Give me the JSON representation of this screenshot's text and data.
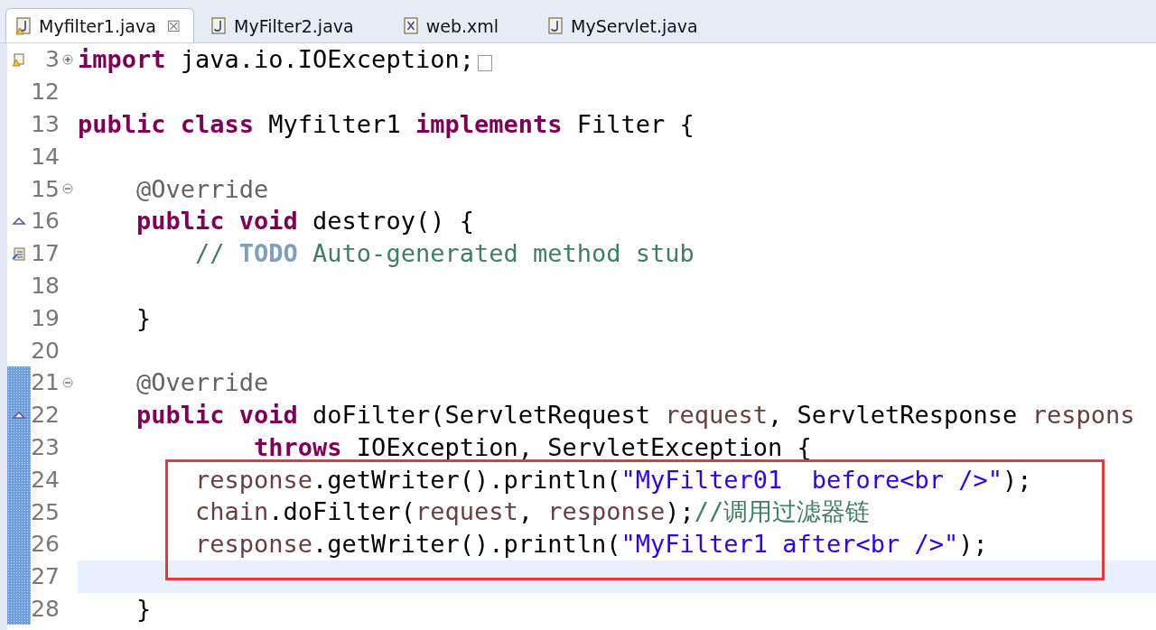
{
  "tabs": [
    {
      "label": "Myfilter1.java",
      "kind": "java",
      "selected": true,
      "warning": true,
      "close": "☒"
    },
    {
      "label": "MyFilter2.java",
      "kind": "java",
      "selected": false,
      "warning": false
    },
    {
      "label": "web.xml",
      "kind": "xml",
      "selected": false,
      "warning": false
    },
    {
      "label": "MyServlet.java",
      "kind": "java",
      "selected": false,
      "warning": false
    }
  ],
  "lines": [
    {
      "number": "3",
      "fold": {
        "expanded": false
      },
      "marker": {
        "kind": "warning"
      },
      "changed": false,
      "current": false,
      "boxed": false,
      "folded_rest": true,
      "tokens": [
        {
          "kind": "kw",
          "text": "import"
        },
        {
          "kind": "plain",
          "text": " java.io.IOException;"
        }
      ]
    },
    {
      "number": "12",
      "changed": false,
      "current": false,
      "boxed": false
    },
    {
      "number": "13",
      "changed": false,
      "current": false,
      "boxed": false,
      "tokens": [
        {
          "kind": "kw",
          "text": "public class"
        },
        {
          "kind": "plain",
          "text": " Myfilter1 "
        },
        {
          "kind": "kw",
          "text": "implements"
        },
        {
          "kind": "plain",
          "text": " Filter {"
        }
      ]
    },
    {
      "number": "14",
      "changed": false,
      "current": false,
      "boxed": false
    },
    {
      "number": "15",
      "fold": {
        "expanded": true
      },
      "changed": false,
      "current": false,
      "boxed": false,
      "tokens": [
        {
          "kind": "ann",
          "text": "    @Override"
        }
      ]
    },
    {
      "number": "16",
      "marker": {
        "kind": "override"
      },
      "changed": false,
      "current": false,
      "boxed": false,
      "tokens": [
        {
          "kind": "kw",
          "text": "    public void"
        },
        {
          "kind": "plain",
          "text": " destroy() {"
        }
      ]
    },
    {
      "number": "17",
      "marker": {
        "kind": "task"
      },
      "changed": false,
      "current": false,
      "boxed": false,
      "tokens": [
        {
          "kind": "comment",
          "text": "        //"
        },
        {
          "kind": "todo",
          "text": " TODO"
        },
        {
          "kind": "comment",
          "text": " Auto-generated method stub"
        }
      ]
    },
    {
      "number": "18",
      "changed": false,
      "current": false,
      "boxed": false
    },
    {
      "number": "19",
      "changed": false,
      "current": false,
      "boxed": false,
      "tokens": [
        {
          "kind": "plain",
          "text": "    }"
        }
      ]
    },
    {
      "number": "20",
      "changed": false,
      "current": false,
      "boxed": false
    },
    {
      "number": "21",
      "fold": {
        "expanded": true
      },
      "changed": true,
      "current": false,
      "boxed": false,
      "tokens": [
        {
          "kind": "ann",
          "text": "    @Override"
        }
      ]
    },
    {
      "number": "22",
      "marker": {
        "kind": "override"
      },
      "changed": true,
      "current": false,
      "boxed": false,
      "tokens": [
        {
          "kind": "kw",
          "text": "    public void"
        },
        {
          "kind": "plain",
          "text": " doFilter(ServletRequest "
        },
        {
          "kind": "var",
          "text": "request"
        },
        {
          "kind": "plain",
          "text": ", ServletResponse "
        },
        {
          "kind": "var",
          "text": "respons"
        }
      ]
    },
    {
      "number": "23",
      "changed": true,
      "current": false,
      "boxed": false,
      "tokens": [
        {
          "kind": "kw",
          "text": "            throws"
        },
        {
          "kind": "plain",
          "text": " IOException, ServletException {"
        }
      ]
    },
    {
      "number": "24",
      "changed": true,
      "current": false,
      "boxed": true,
      "tokens": [
        {
          "kind": "var",
          "text": "        response"
        },
        {
          "kind": "plain",
          "text": ".getWriter().println("
        },
        {
          "kind": "str",
          "text": "\"MyFilter01  before<br />\""
        },
        {
          "kind": "plain",
          "text": ");"
        }
      ]
    },
    {
      "number": "25",
      "changed": true,
      "current": false,
      "boxed": true,
      "tokens": [
        {
          "kind": "var",
          "text": "        chain"
        },
        {
          "kind": "plain",
          "text": ".doFilter("
        },
        {
          "kind": "var",
          "text": "request"
        },
        {
          "kind": "plain",
          "text": ", "
        },
        {
          "kind": "var",
          "text": "response"
        },
        {
          "kind": "plain",
          "text": ");"
        },
        {
          "kind": "comment",
          "text": "//调用过滤器链"
        }
      ]
    },
    {
      "number": "26",
      "changed": true,
      "current": false,
      "boxed": true,
      "tokens": [
        {
          "kind": "var",
          "text": "        response"
        },
        {
          "kind": "plain",
          "text": ".getWriter().println("
        },
        {
          "kind": "str",
          "text": "\"MyFilter1 after<br />\""
        },
        {
          "kind": "plain",
          "text": ");"
        }
      ]
    },
    {
      "number": "27",
      "changed": true,
      "current": true,
      "boxed": false
    },
    {
      "number": "28",
      "changed": true,
      "current": false,
      "boxed": false,
      "tokens": [
        {
          "kind": "plain",
          "text": "    }"
        }
      ]
    }
  ]
}
